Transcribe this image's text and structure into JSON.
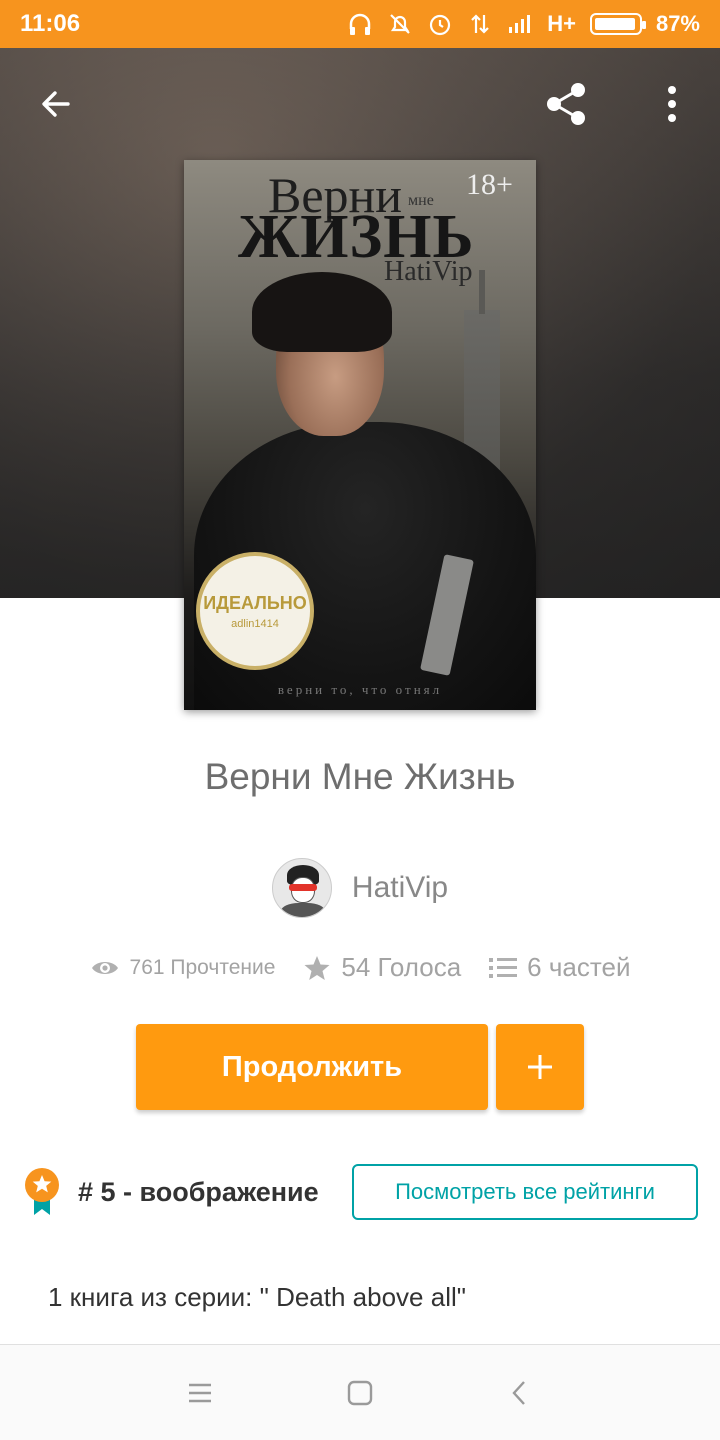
{
  "status_bar": {
    "time": "11:06",
    "network": "H+",
    "battery": "87%",
    "icons": [
      "headphones-icon",
      "mute-icon",
      "alarm-icon",
      "data-transfer-icon",
      "signal-icon",
      "battery-icon"
    ]
  },
  "toolbar": {
    "icons": [
      "back-arrow-icon",
      "share-icon",
      "more-vertical-icon"
    ]
  },
  "cover": {
    "title_line1": "Верни",
    "title_small": "мне",
    "rating": "18+",
    "title_line2": "ЖИЗНЬ",
    "author": "HatiVip",
    "stamp_main": "ИДЕАЛЬНО",
    "stamp_sub": "adlin1414",
    "tagline": "верни то, что отнял"
  },
  "book": {
    "title": "Верни Мне Жизнь",
    "author": "HatiVip"
  },
  "stats": {
    "reads": "761 Прочтение",
    "votes": "54 Голоса",
    "parts": "6 частей"
  },
  "actions": {
    "continue_label": "Продолжить",
    "add_label": "+"
  },
  "ranking": {
    "text": "# 5 - воображение",
    "button_label": "Посмотреть все рейтинги"
  },
  "description": {
    "series": "1 книга из серии: \" Death above all\""
  },
  "colors": {
    "accent": "#ff9a0f",
    "status_bar": "#f7941e",
    "teal": "#00a2a6"
  }
}
